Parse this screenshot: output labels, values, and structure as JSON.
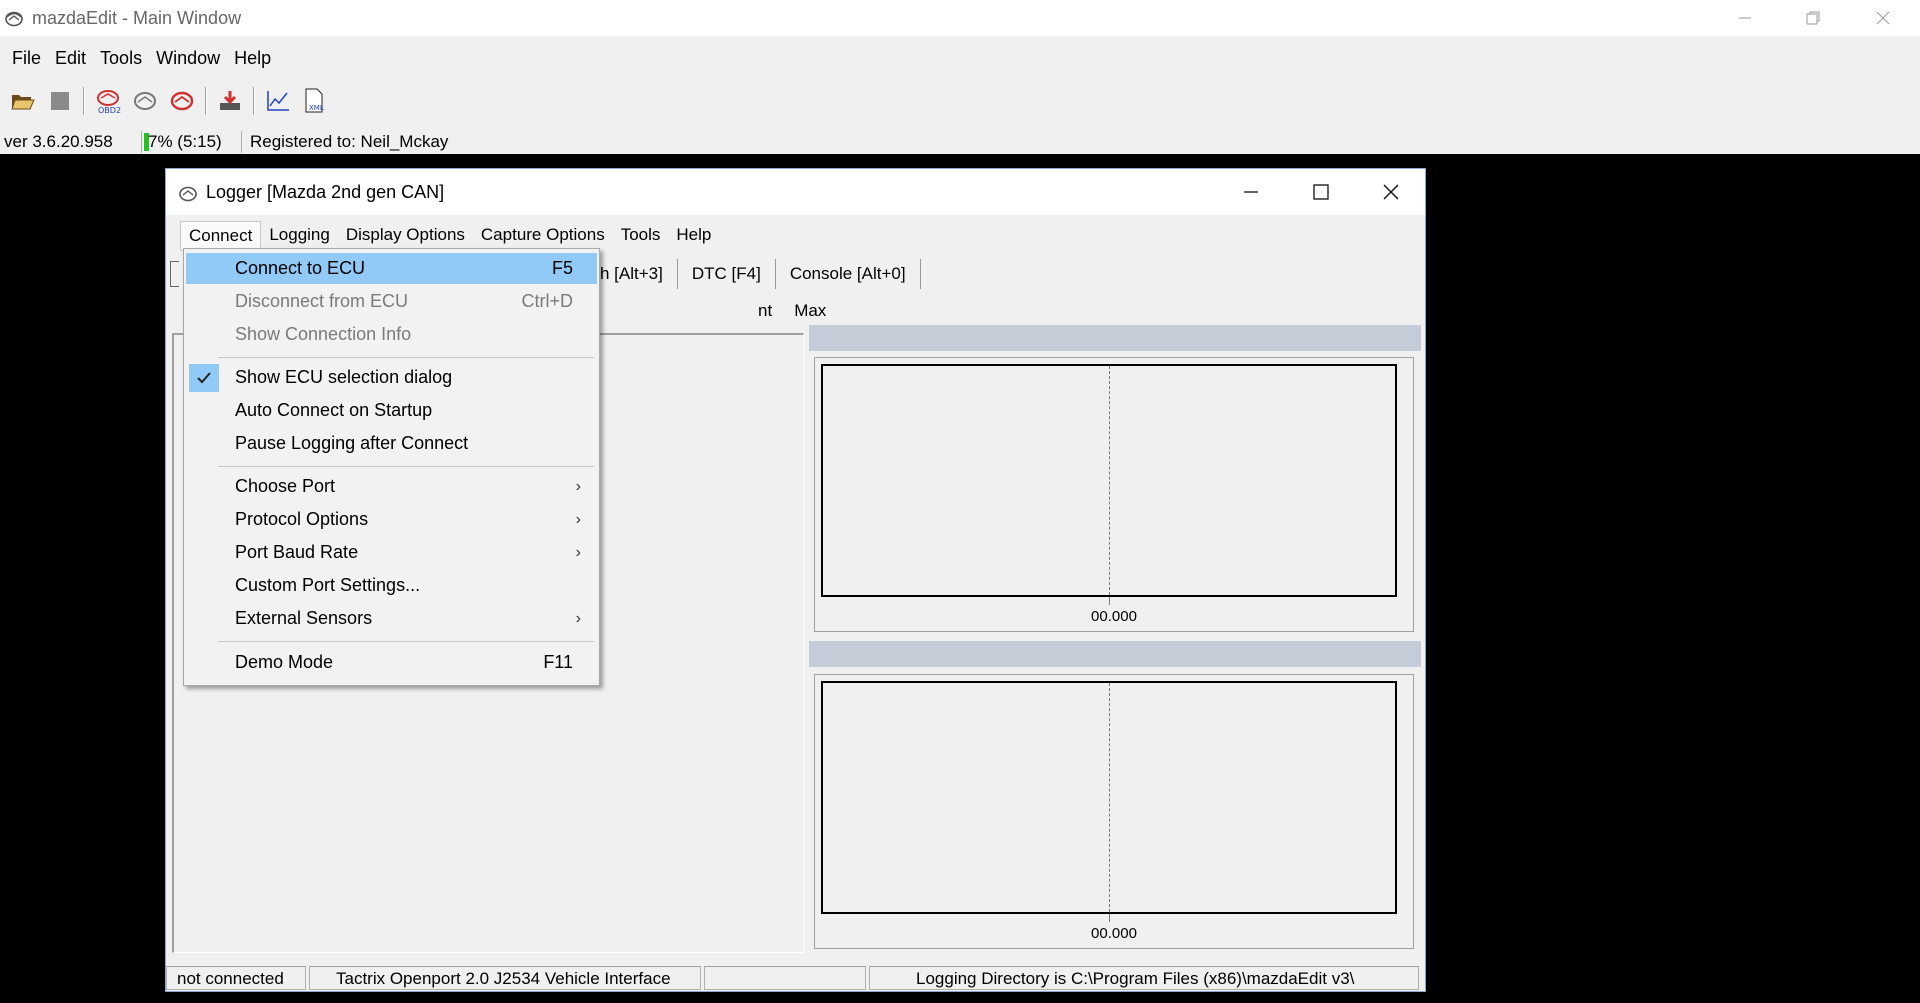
{
  "main_window": {
    "title": "mazdaEdit - Main Window",
    "menu": [
      "File",
      "Edit",
      "Tools",
      "Window",
      "Help"
    ],
    "toolbar_icons": [
      "open-folder-icon",
      "stop-icon",
      "obd2-icon",
      "ecu-icon",
      "ecu-red-icon",
      "download-flash-icon",
      "chart-icon",
      "xml-doc-icon"
    ],
    "status": {
      "version": "ver 3.6.20.958",
      "progress": "7% (5:15)",
      "progress_value": 0.07,
      "registered": "Registered to: Neil_Mckay"
    }
  },
  "logger": {
    "title": "Logger [Mazda 2nd gen CAN]",
    "menu": [
      "Connect",
      "Logging",
      "Display Options",
      "Capture Options",
      "Tools",
      "Help"
    ],
    "tabs": [
      "h [Alt+3]",
      "DTC [F4]",
      "Console [Alt+0]"
    ],
    "column_headers": [
      "nt",
      "Max"
    ],
    "gauges": [
      {
        "value": "00.000"
      },
      {
        "value": "00.000"
      }
    ],
    "status": {
      "connection": "not connected",
      "interface": "Tactrix Openport 2.0 J2534 Vehicle Interface",
      "empty": "",
      "logging_dir": "Logging Directory is C:\\Program Files (x86)\\mazdaEdit v3\\"
    }
  },
  "connect_menu": {
    "items": [
      {
        "label": "Connect to ECU",
        "shortcut": "F5"
      },
      {
        "label": "Disconnect from ECU",
        "shortcut": "Ctrl+D"
      },
      {
        "label": "Show Connection Info",
        "shortcut": ""
      },
      {
        "label": "Show ECU selection dialog",
        "shortcut": "",
        "checked": true
      },
      {
        "label": "Auto Connect on Startup",
        "shortcut": ""
      },
      {
        "label": "Pause Logging after Connect",
        "shortcut": ""
      },
      {
        "label": "Choose Port",
        "shortcut": ""
      },
      {
        "label": "Protocol Options",
        "shortcut": ""
      },
      {
        "label": "Port Baud Rate",
        "shortcut": ""
      },
      {
        "label": "Custom Port Settings...",
        "shortcut": ""
      },
      {
        "label": "External Sensors",
        "shortcut": ""
      },
      {
        "label": "Demo Mode",
        "shortcut": "F11"
      }
    ]
  },
  "colors": {
    "highlight": "#91c9f7",
    "gauge_header": "#c3ccd7",
    "progress_green": "#22c022"
  }
}
